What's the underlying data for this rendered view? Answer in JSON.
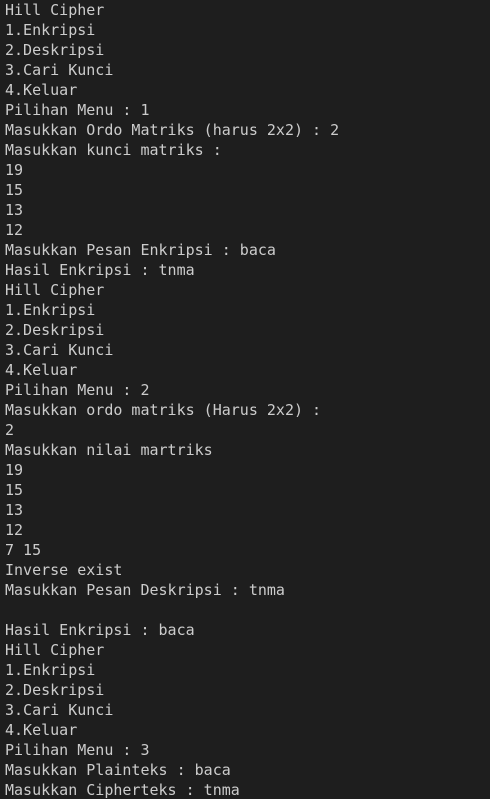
{
  "terminal": {
    "background": "#1e1e1e",
    "foreground": "#cccccc",
    "lines": [
      "Hill Cipher",
      "1.Enkripsi",
      "2.Deskripsi",
      "3.Cari Kunci",
      "4.Keluar",
      "Pilihan Menu : 1",
      "Masukkan Ordo Matriks (harus 2x2) : 2",
      "Masukkan kunci matriks :",
      "19",
      "15",
      "13",
      "12",
      "Masukkan Pesan Enkripsi : baca",
      "Hasil Enkripsi : tnma",
      "Hill Cipher",
      "1.Enkripsi",
      "2.Deskripsi",
      "3.Cari Kunci",
      "4.Keluar",
      "Pilihan Menu : 2",
      "Masukkan ordo matriks (Harus 2x2) :",
      "2",
      "Masukkan nilai martriks",
      "19",
      "15",
      "13",
      "12",
      "7 15",
      "Inverse exist",
      "Masukkan Pesan Deskripsi : tnma",
      "",
      "Hasil Enkripsi : baca",
      "Hill Cipher",
      "1.Enkripsi",
      "2.Deskripsi",
      "3.Cari Kunci",
      "4.Keluar",
      "Pilihan Menu : 3",
      "Masukkan Plainteks : baca",
      "Masukkan Cipherteks : tnma"
    ]
  }
}
